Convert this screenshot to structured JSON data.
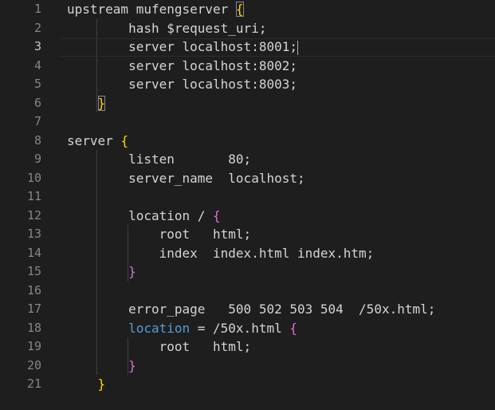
{
  "editor": {
    "lines": [
      {
        "number": "1",
        "segments": [
          {
            "text": "upstream mufengserver ",
            "style": "default"
          },
          {
            "text": "{",
            "style": "bracket1",
            "match": true
          }
        ]
      },
      {
        "number": "2",
        "segments": [
          {
            "text": "        hash $request_uri;",
            "style": "default"
          }
        ]
      },
      {
        "number": "3",
        "segments": [
          {
            "text": "        server localhost:8001;",
            "style": "default"
          }
        ],
        "current": true,
        "cursor": true
      },
      {
        "number": "4",
        "segments": [
          {
            "text": "        server localhost:8002;",
            "style": "default"
          }
        ]
      },
      {
        "number": "5",
        "segments": [
          {
            "text": "        server localhost:8003;",
            "style": "default"
          }
        ]
      },
      {
        "number": "6",
        "segments": [
          {
            "text": "    ",
            "style": "default"
          },
          {
            "text": "}",
            "style": "bracket1",
            "match": true
          }
        ]
      },
      {
        "number": "7",
        "segments": []
      },
      {
        "number": "8",
        "segments": [
          {
            "text": "server ",
            "style": "default"
          },
          {
            "text": "{",
            "style": "bracket1"
          }
        ]
      },
      {
        "number": "9",
        "segments": [
          {
            "text": "        listen       80;",
            "style": "default"
          }
        ]
      },
      {
        "number": "10",
        "segments": [
          {
            "text": "        server_name  localhost;",
            "style": "default"
          }
        ]
      },
      {
        "number": "11",
        "segments": []
      },
      {
        "number": "12",
        "segments": [
          {
            "text": "        location / ",
            "style": "default"
          },
          {
            "text": "{",
            "style": "bracket2"
          }
        ]
      },
      {
        "number": "13",
        "segments": [
          {
            "text": "            root   html;",
            "style": "default"
          }
        ]
      },
      {
        "number": "14",
        "segments": [
          {
            "text": "            index  index.html index.htm;",
            "style": "default"
          }
        ]
      },
      {
        "number": "15",
        "segments": [
          {
            "text": "        ",
            "style": "default"
          },
          {
            "text": "}",
            "style": "bracket2"
          }
        ]
      },
      {
        "number": "16",
        "segments": []
      },
      {
        "number": "17",
        "segments": [
          {
            "text": "        error_page   500 502 503 504  /50x.html;",
            "style": "default"
          }
        ]
      },
      {
        "number": "18",
        "segments": [
          {
            "text": "        ",
            "style": "default"
          },
          {
            "text": "location",
            "style": "keyword"
          },
          {
            "text": " = /50x.html ",
            "style": "default"
          },
          {
            "text": "{",
            "style": "bracket2"
          }
        ]
      },
      {
        "number": "19",
        "segments": [
          {
            "text": "            root   html;",
            "style": "default"
          }
        ]
      },
      {
        "number": "20",
        "segments": [
          {
            "text": "        ",
            "style": "default"
          },
          {
            "text": "}",
            "style": "bracket2"
          }
        ]
      },
      {
        "number": "21",
        "segments": [
          {
            "text": "    ",
            "style": "default"
          },
          {
            "text": "}",
            "style": "bracket1"
          }
        ]
      }
    ],
    "colors": {
      "background": "#1e1e1e",
      "text": "#d4d4d4",
      "line_number": "#858585",
      "active_line_number": "#c6c6c6",
      "keyword": "#569cd6",
      "bracket_level1": "#ffd700",
      "bracket_level2": "#da70d6",
      "indent_guide": "#404040"
    }
  }
}
